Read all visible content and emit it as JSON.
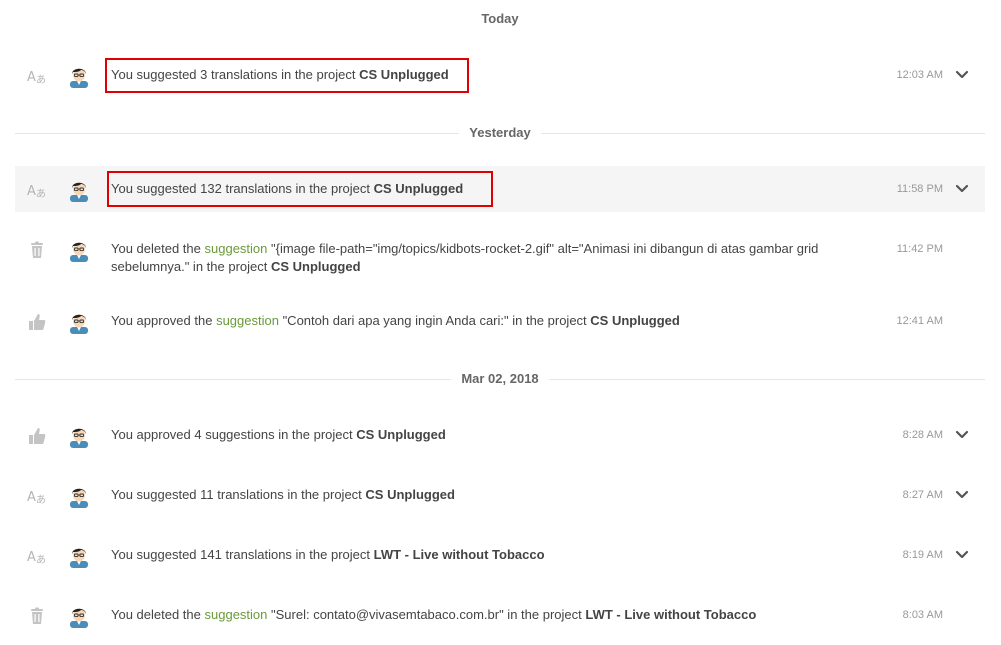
{
  "groups": {
    "today": "Today",
    "yesterday": "Yesterday",
    "mar02": "Mar 02, 2018"
  },
  "rows": [
    {
      "icon": "translate-icon",
      "parts": [
        "You suggested 3 translations in the project ",
        "CS Unplugged"
      ],
      "time": "12:03 AM",
      "expandable": true
    },
    {
      "icon": "translate-icon",
      "parts": [
        "You suggested 132 translations in the project ",
        "CS Unplugged"
      ],
      "time": "11:58 PM",
      "expandable": true
    },
    {
      "icon": "trash-icon",
      "pre": "You deleted the ",
      "link": "suggestion",
      "mid": " \"{image file-path=\"img/topics/kidbots-rocket-2.gif\" alt=\"Animasi ini dibangun di atas gambar grid sebelumnya.\" in the project ",
      "project": "CS Unplugged",
      "time": "11:42 PM",
      "expandable": false
    },
    {
      "icon": "thumbs-up-icon",
      "pre": "You approved the ",
      "link": "suggestion",
      "mid": " \"Contoh dari apa yang ingin Anda cari:\" in the project ",
      "project": "CS Unplugged",
      "time": "12:41 AM",
      "expandable": false
    },
    {
      "icon": "thumbs-up-icon",
      "parts": [
        "You approved 4 suggestions in the project ",
        "CS Unplugged"
      ],
      "time": "8:28 AM",
      "expandable": true
    },
    {
      "icon": "translate-icon",
      "parts": [
        "You suggested 11 translations in the project ",
        "CS Unplugged"
      ],
      "time": "8:27 AM",
      "expandable": true
    },
    {
      "icon": "translate-icon",
      "parts": [
        "You suggested 141 translations in the project ",
        "LWT - Live without Tobacco"
      ],
      "time": "8:19 AM",
      "expandable": true
    },
    {
      "icon": "trash-icon",
      "pre": "You deleted the ",
      "link": "suggestion",
      "mid": " \"Surel: contato@vivasemtabaco.com.br\" in the project ",
      "project": "LWT - Live without Tobacco",
      "time": "8:03 AM",
      "expandable": false
    }
  ],
  "colors": {
    "link": "#6a9a3a",
    "highlight_box": "#e00000",
    "row_hover": "#f5f5f5"
  }
}
